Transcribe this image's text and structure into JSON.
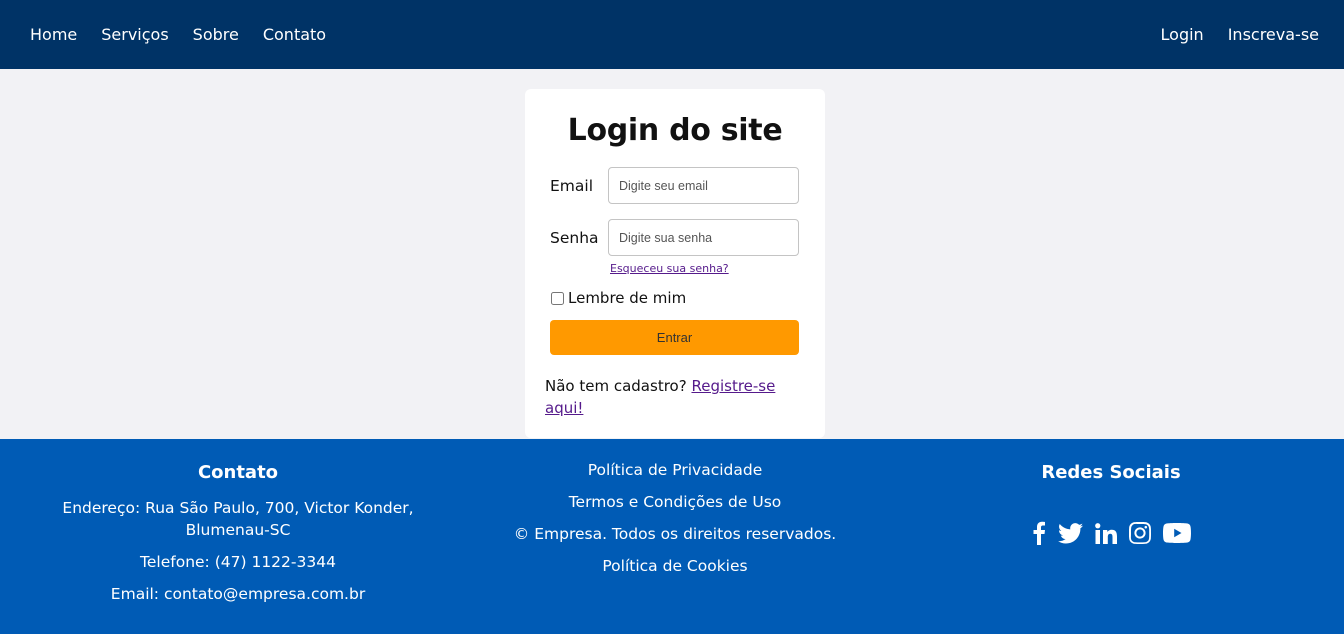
{
  "nav": {
    "home": "Home",
    "services": "Serviços",
    "about": "Sobre",
    "contact": "Contato",
    "login": "Login",
    "signup": "Inscreva-se"
  },
  "login": {
    "title": "Login do site",
    "email_label": "Email",
    "email_placeholder": "Digite seu email",
    "password_label": "Senha",
    "password_placeholder": "Digite sua senha",
    "forgot": "Esqueceu sua senha?",
    "remember": "Lembre de mim",
    "submit": "Entrar",
    "no_account": "Não tem cadastro?",
    "register_link": "Registre-se aqui!"
  },
  "footer": {
    "contact_title": "Contato",
    "address": "Endereço: Rua São Paulo, 700, Victor Konder, Blumenau-SC",
    "phone": "Telefone: (47) 1122-3344",
    "email": "Email: contato@empresa.com.br",
    "privacy": "Política de Privacidade",
    "terms": "Termos e Condições de Uso",
    "copyright": "© Empresa. Todos os direitos reservados.",
    "cookies": "Política de Cookies",
    "social_title": "Redes Sociais",
    "social_icons": [
      "facebook-icon",
      "twitter-icon",
      "linkedin-icon",
      "instagram-icon",
      "youtube-icon"
    ]
  },
  "colors": {
    "nav_bg": "#003366",
    "footer_bg": "#005bb5",
    "button": "#ff9900",
    "page_bg": "#f2f2f5"
  }
}
